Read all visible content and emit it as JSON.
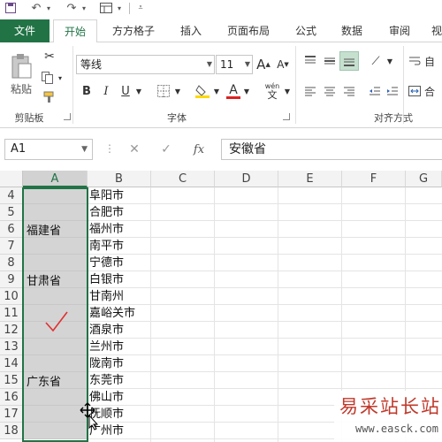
{
  "ribbon_tabs": [
    "文件",
    "开始",
    "方方格子",
    "插入",
    "页面布局",
    "公式",
    "数据",
    "审阅",
    "视"
  ],
  "active_tab": "开始",
  "clipboard": {
    "paste_label": "粘贴",
    "group_label": "剪贴板"
  },
  "font": {
    "name": "等线",
    "size": "11",
    "grow_label": "A",
    "shrink_label": "A",
    "bold_label": "B",
    "italic_label": "I",
    "underline_label": "U",
    "font_color_label": "A",
    "phonetic_label": "wén",
    "group_label": "字体"
  },
  "alignment": {
    "group_label": "对齐方式",
    "wrap_label": "自",
    "merge_label": "合"
  },
  "colors": {
    "accent": "#217346",
    "font_color": "#e02020",
    "fill_color": "#ffd800",
    "check_mark": "#e03030"
  },
  "formula_bar": {
    "name_box": "A1",
    "cancel_symbol": "✕",
    "enter_symbol": "✓",
    "fx_label": "fx",
    "content": "安徽省"
  },
  "columns": [
    "A",
    "B",
    "C",
    "D",
    "E",
    "F",
    "G"
  ],
  "rows": [
    {
      "num": "4",
      "b": "阜阳市"
    },
    {
      "num": "5",
      "b": "合肥市"
    },
    {
      "num": "6",
      "b": "福州市"
    },
    {
      "num": "7",
      "b": "南平市"
    },
    {
      "num": "8",
      "b": "宁德市"
    },
    {
      "num": "9",
      "b": "白银市"
    },
    {
      "num": "10",
      "b": "甘南州"
    },
    {
      "num": "11",
      "b": "嘉峪关市"
    },
    {
      "num": "12",
      "b": "酒泉市"
    },
    {
      "num": "13",
      "b": "兰州市"
    },
    {
      "num": "14",
      "b": "陇南市"
    },
    {
      "num": "15",
      "b": "东莞市"
    },
    {
      "num": "16",
      "b": "佛山市"
    },
    {
      "num": "17",
      "b": "抚顺市"
    },
    {
      "num": "18",
      "b": "广州市"
    }
  ],
  "merged_labels": [
    "福建省",
    "甘肃省",
    "广东省"
  ],
  "watermark": {
    "title": "易采站长站",
    "url": "www.easck.com"
  }
}
